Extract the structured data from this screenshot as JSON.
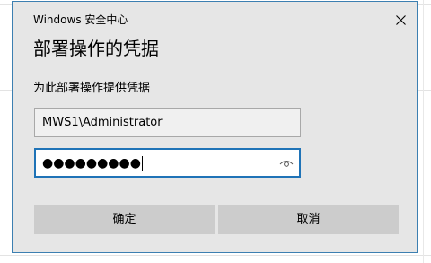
{
  "dialog": {
    "app_title": "Windows 安全中心",
    "heading": "部署操作的凭据",
    "subtext": "为此部署操作提供凭据",
    "username_value": "MWS1\\Administrator",
    "password_mask": "●●●●●●●●●",
    "ok_label": "确定",
    "cancel_label": "取消"
  },
  "icons": {
    "close": "close-icon",
    "reveal": "eye-icon"
  },
  "colors": {
    "dialog_bg": "#e6e6e6",
    "border": "#3c7fb1",
    "focus_border": "#1f73b7",
    "button_bg": "#cccccc"
  }
}
